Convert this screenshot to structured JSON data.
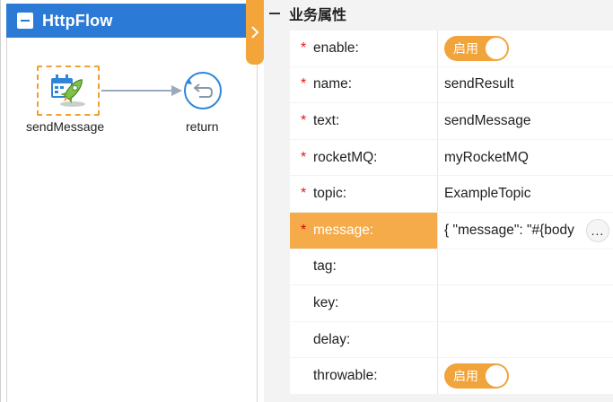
{
  "flow": {
    "title": "HttpFlow",
    "nodes": [
      {
        "label": "sendMessage"
      },
      {
        "label": "return"
      }
    ]
  },
  "properties": {
    "section_title": "业务属性",
    "rows": [
      {
        "key": "enable:",
        "required": true,
        "value": "",
        "toggle_label": "启用"
      },
      {
        "key": "name:",
        "required": true,
        "value": "sendResult"
      },
      {
        "key": "text:",
        "required": true,
        "value": "sendMessage"
      },
      {
        "key": "rocketMQ:",
        "required": true,
        "value": "myRocketMQ"
      },
      {
        "key": "topic:",
        "required": true,
        "value": "ExampleTopic"
      },
      {
        "key": "message:",
        "required": true,
        "value": "{  \"message\": \"#{body",
        "more": "..."
      },
      {
        "key": "tag:",
        "required": false,
        "value": ""
      },
      {
        "key": "key:",
        "required": false,
        "value": ""
      },
      {
        "key": "delay:",
        "required": false,
        "value": ""
      },
      {
        "key": "throwable:",
        "required": false,
        "value": "",
        "toggle_label": "启用"
      }
    ]
  },
  "colors": {
    "header_blue": "#2b7ad6",
    "accent_orange": "#f3a53a",
    "required_red": "#e11111"
  },
  "icons": {
    "collapse": "minus-square-icon",
    "side_tab": "chevron-right-icon",
    "send_node": "rocket-calendar-icon",
    "return_node": "return-arrow-icon"
  }
}
